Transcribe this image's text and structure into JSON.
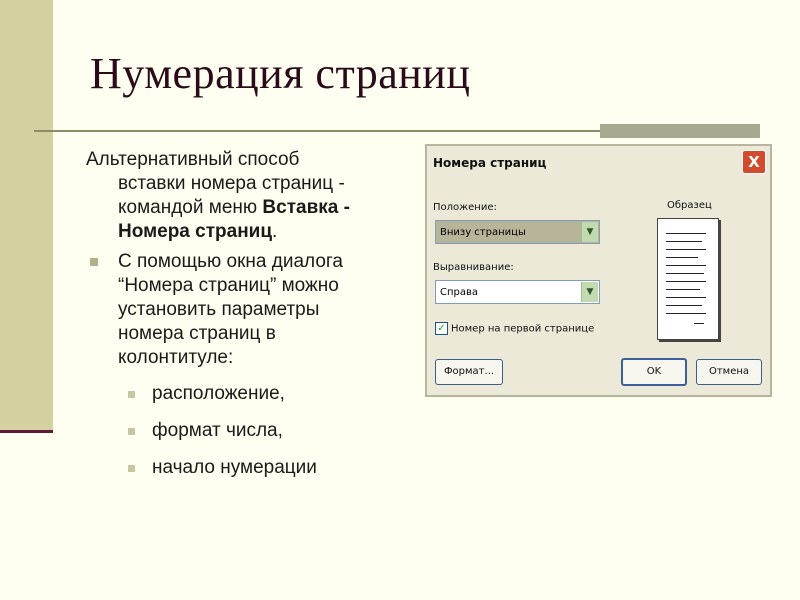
{
  "slide": {
    "title": "Нумерация страниц",
    "paragraph": {
      "line1": "Альтернативный способ",
      "line2": "вставки номера страниц -",
      "line3_prefix": "командой меню ",
      "line3_bold": "Вставка -",
      "line4_bold": "Номера страниц",
      "line4_suffix": "."
    },
    "bullet": {
      "lines": [
        "С помощью окна диалога",
        "“Номера страниц” можно",
        "установить параметры",
        "номера страниц в",
        "колонтитуле:"
      ]
    },
    "sub_items": [
      "расположение,",
      "формат числа,",
      "начало нумерации"
    ]
  },
  "dialog": {
    "title": "Номера страниц",
    "close_glyph": "X",
    "position_label": "Положение:",
    "position_value": "Внизу страницы",
    "alignment_label": "Выравнивание:",
    "alignment_value": "Справа",
    "checkbox_label": "Номер на первой странице",
    "checkbox_mark": "✓",
    "preview_label": "Образец",
    "format_button": "Формат...",
    "ok_button": "OK",
    "cancel_button": "Отмена",
    "arrow_glyph": "▼"
  }
}
